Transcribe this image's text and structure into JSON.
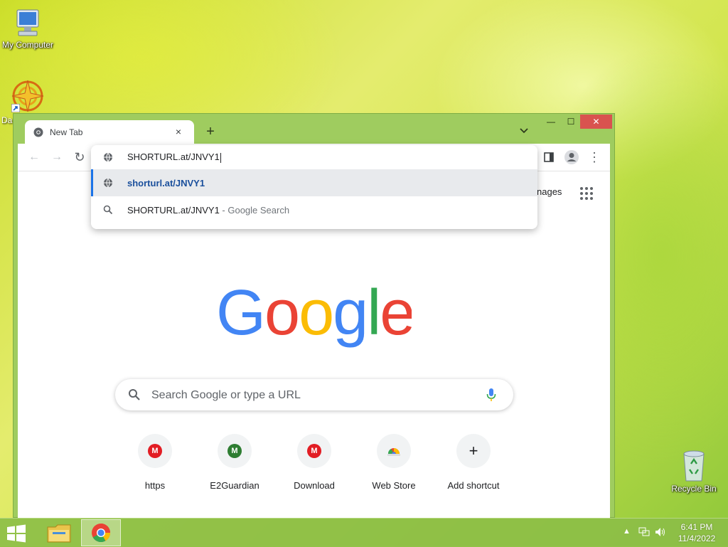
{
  "desktop": {
    "icons": [
      {
        "label": "My Computer"
      },
      {
        "label": "Da"
      },
      {
        "label": "Recycle Bin"
      }
    ]
  },
  "browser": {
    "tab": {
      "title": "New Tab",
      "close_glyph": "×"
    },
    "new_tab_glyph": "+",
    "tab_search_glyph": "⌄",
    "window_controls": {
      "minimize": "—",
      "maximize": "☐",
      "close": "✕"
    },
    "toolbar": {
      "back": "←",
      "forward": "→",
      "reload": "↻",
      "menu": "⋮"
    },
    "omnibox": {
      "input_value": "SHORTURL.at/JNVY1",
      "suggestions": [
        {
          "text": "shorturl.at/JNVY1",
          "icon": "globe-icon"
        },
        {
          "text": "SHORTURL.at/JNVY1",
          "sub": " - Google Search",
          "icon": "search-icon"
        }
      ]
    },
    "ntp": {
      "images_link": "Images",
      "images_visible": "nages",
      "search_placeholder": "Search Google or type a URL",
      "shortcuts": [
        {
          "label": "https",
          "badge": "M",
          "color": "#e21d24"
        },
        {
          "label": "E2Guardian",
          "badge": "M",
          "color": "#2e7d32"
        },
        {
          "label": "Download",
          "badge": "M",
          "color": "#e21d24"
        },
        {
          "label": "Web Store",
          "badge": "",
          "color": "#f1f3f4"
        },
        {
          "label": "Add shortcut",
          "badge": "+",
          "color": "#f1f3f4"
        }
      ]
    }
  },
  "taskbar": {
    "time": "6:41 PM",
    "date": "11/4/2022"
  },
  "colors": {
    "google_blue": "#4285f4",
    "google_red": "#ea4335",
    "google_yellow": "#fbbc05",
    "google_green": "#34a853",
    "window_frame": "#9fcc5f"
  }
}
